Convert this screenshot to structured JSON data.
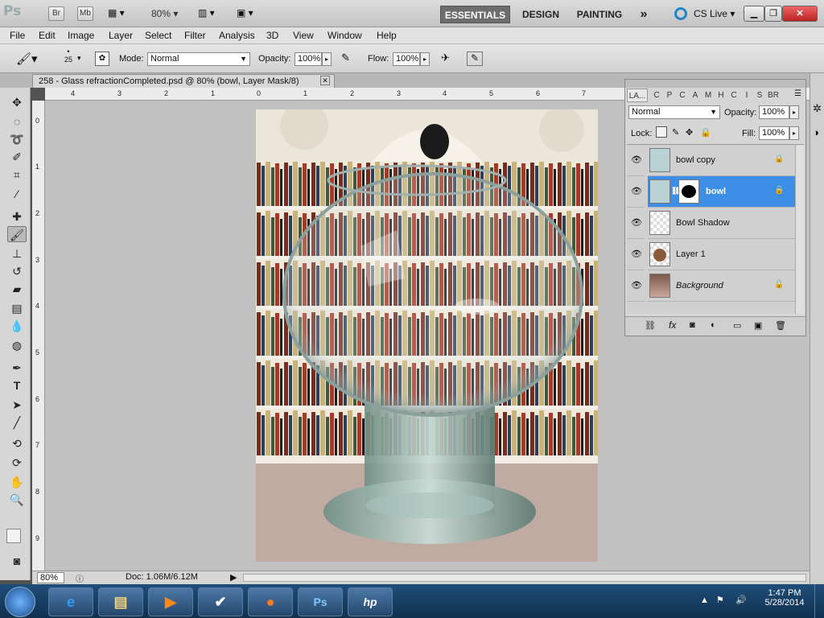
{
  "appbar": {
    "logo": "Ps",
    "br_label": "Br",
    "mb_label": "Mb",
    "zoom": "80%",
    "workspaces": [
      "ESSENTIALS",
      "DESIGN",
      "PAINTING"
    ],
    "more": "»",
    "cs_live": "CS Live"
  },
  "menu": [
    "File",
    "Edit",
    "Image",
    "Layer",
    "Select",
    "Filter",
    "Analysis",
    "3D",
    "View",
    "Window",
    "Help"
  ],
  "options": {
    "brush_size": "25",
    "mode_label": "Mode:",
    "mode_value": "Normal",
    "opacity_label": "Opacity:",
    "opacity_value": "100%",
    "flow_label": "Flow:",
    "flow_value": "100%"
  },
  "document": {
    "tab_title": "258 - Glass refractionCompleted.psd @ 80% (bowl, Layer Mask/8)",
    "status_zoom": "80%",
    "status_doc": "Doc: 1.06M/6.12M"
  },
  "rulers": {
    "top": [
      "4",
      "3",
      "2",
      "1",
      "0",
      "1",
      "2",
      "3",
      "4",
      "5",
      "6",
      "7"
    ],
    "left": [
      "0",
      "1",
      "2",
      "3",
      "4",
      "5",
      "6",
      "7",
      "8",
      "9"
    ]
  },
  "layers_panel": {
    "tabs": [
      "LA...",
      "C",
      "P",
      "C",
      "A",
      "M",
      "H",
      "C",
      "I",
      "S",
      "BR"
    ],
    "blend_mode": "Normal",
    "opacity_label": "Opacity:",
    "opacity_value": "100%",
    "lock_label": "Lock:",
    "fill_label": "Fill:",
    "fill_value": "100%",
    "layers": [
      {
        "name": "bowl copy",
        "locked": true,
        "selected": false
      },
      {
        "name": "bowl",
        "locked": true,
        "selected": true
      },
      {
        "name": "Bowl Shadow",
        "locked": false,
        "selected": false
      },
      {
        "name": "Layer 1",
        "locked": false,
        "selected": false
      },
      {
        "name": "Background",
        "locked": true,
        "selected": false
      }
    ]
  },
  "taskbar": {
    "time": "1:47 PM",
    "date": "5/28/2014",
    "ps_label": "Ps",
    "hp_label": "hp"
  },
  "colors": {
    "selected_layer": "#3d8ee6",
    "workspace_active": "#6d6d6d",
    "taskbar": "#1a3f66"
  }
}
